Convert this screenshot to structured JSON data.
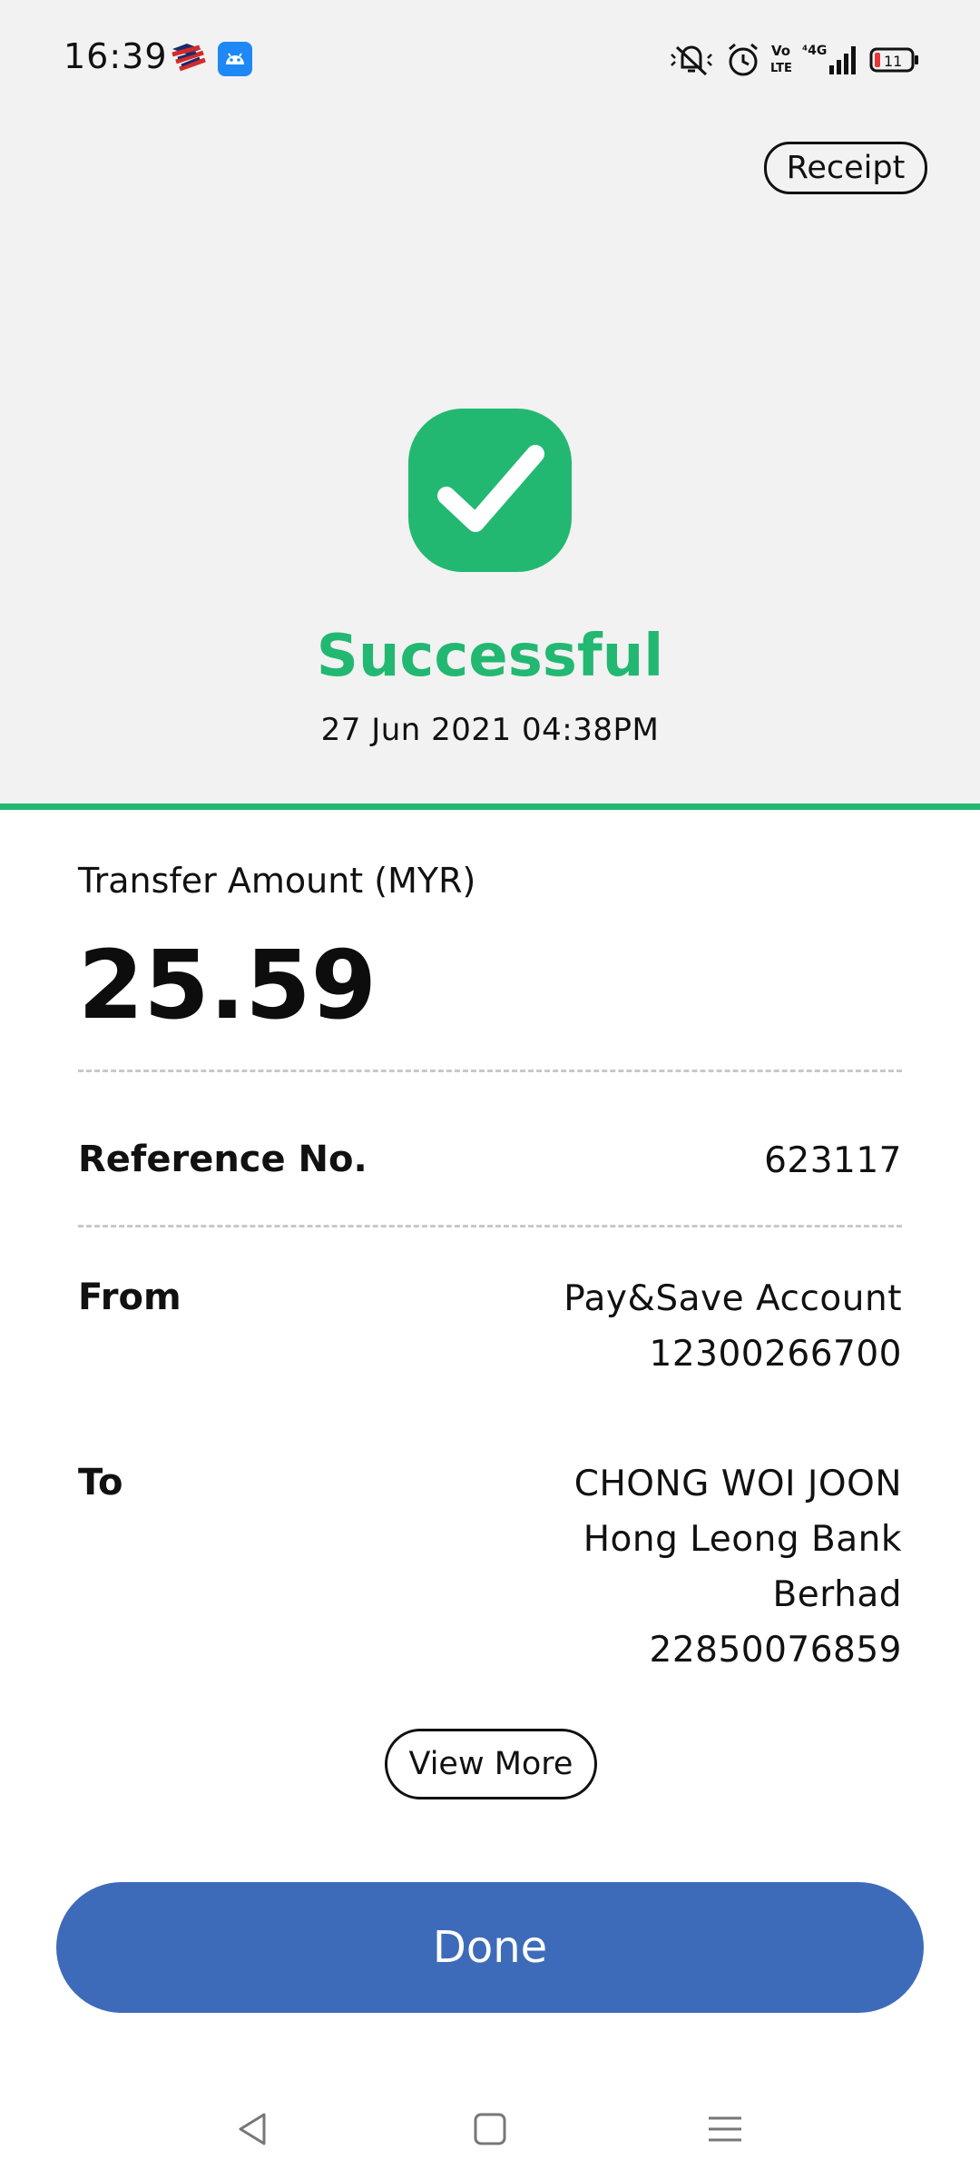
{
  "status_bar": {
    "time": "16:39",
    "icons": [
      "maybank-app-icon",
      "android-app-icon",
      "mute-icon",
      "alarm-icon",
      "volte-icon",
      "signal-4g-icon",
      "battery-icon"
    ],
    "battery_level": "11"
  },
  "header": {
    "receipt_label": "Receipt"
  },
  "result": {
    "icon": "check-icon",
    "status": "Successful",
    "datetime": "27 Jun 2021 04:38PM",
    "accent_color": "#22b871"
  },
  "transfer": {
    "amount_label": "Transfer Amount (MYR)",
    "amount": "25.59",
    "reference_label": "Reference No.",
    "reference": "623117",
    "from_label": "From",
    "from_lines": [
      "Pay&Save Account",
      "12300266700"
    ],
    "to_label": "To",
    "to_lines": [
      "CHONG WOI JOON",
      "Hong Leong Bank",
      "Berhad",
      "22850076859"
    ]
  },
  "actions": {
    "view_more_label": "View More",
    "done_label": "Done",
    "done_color": "#3e6bb9"
  },
  "nav": {
    "icons": [
      "back-icon",
      "home-icon",
      "menu-icon"
    ]
  }
}
